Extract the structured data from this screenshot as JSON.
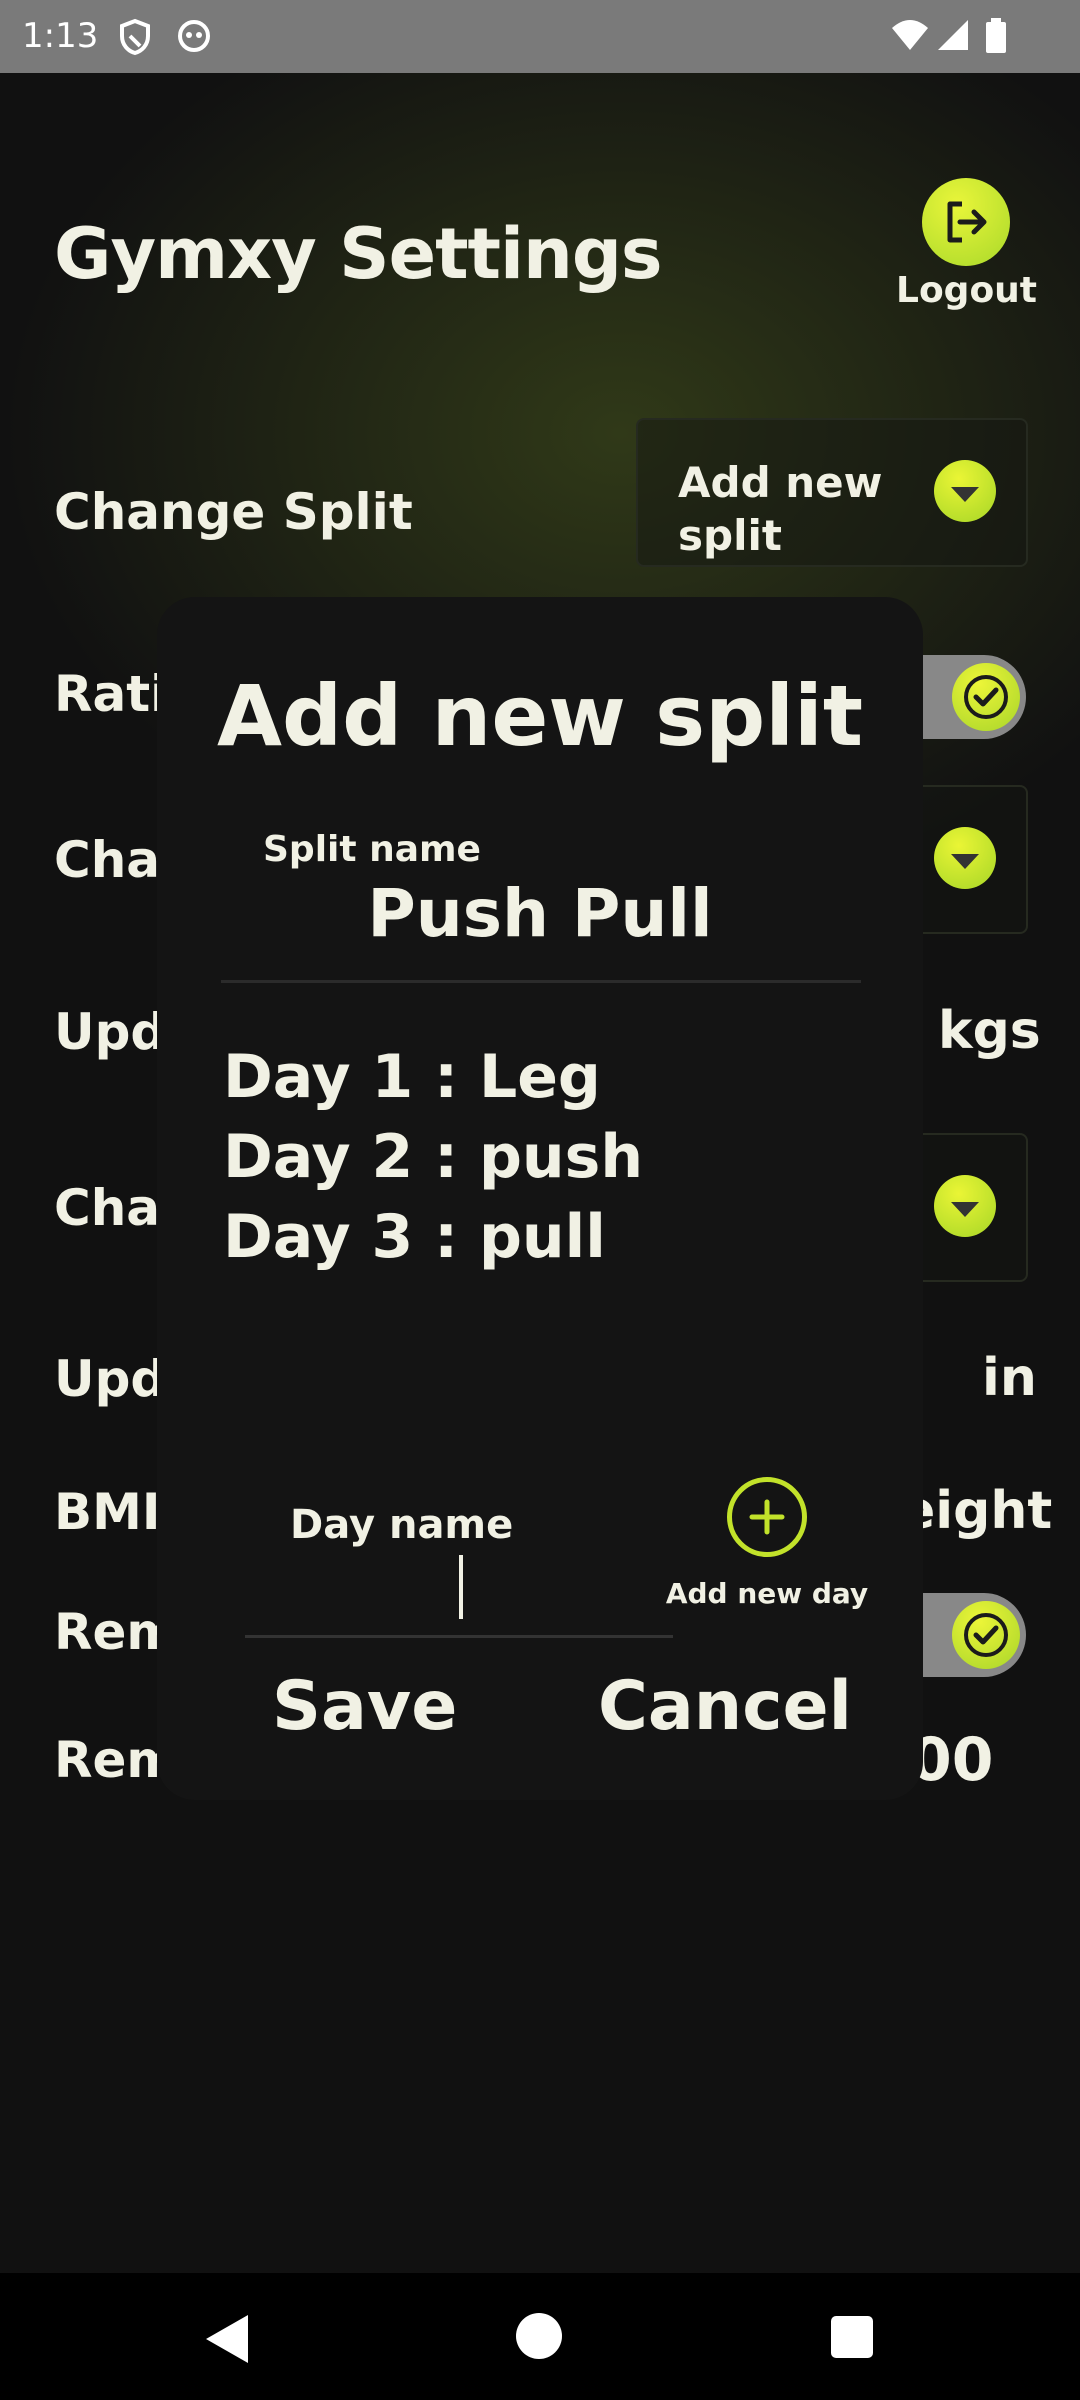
{
  "status_bar": {
    "time": "1:13"
  },
  "header": {
    "title": "Gymxy Settings",
    "logout_label": "Logout"
  },
  "settings": {
    "change_split_label": "Change Split",
    "change_split_value": "Add new split",
    "row2_label": "Rati",
    "row3_label": "Char",
    "row4_label": "Upd",
    "row4_value": "kgs",
    "row5_label": "Char",
    "row6_label": "Upd",
    "row6_value": "in",
    "row7_label": "BMI",
    "row7_value": "eight",
    "row8_label": "Rem",
    "row9_label": "Rem",
    "row9_value": "00"
  },
  "dialog": {
    "title": "Add new split",
    "split_name_label": "Split name",
    "split_name_value": "Push Pull",
    "days": [
      "Day 1 : Leg",
      "Day 2 : push",
      "Day 3 : pull"
    ],
    "day_name_label": "Day name",
    "add_day_label": "Add new day",
    "save_label": "Save",
    "cancel_label": "Cancel"
  },
  "colors": {
    "accent": "#c2e22a",
    "background": "#111111",
    "text": "#f1f1e4"
  }
}
